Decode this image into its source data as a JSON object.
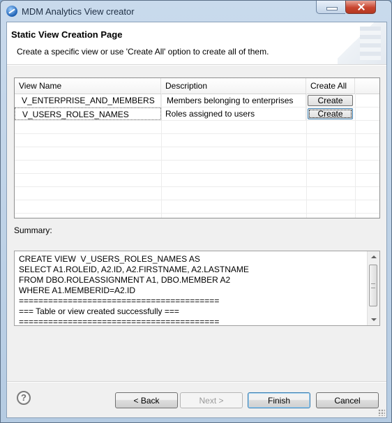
{
  "window": {
    "title": "MDM Analytics View creator",
    "icon": "app-globe-icon"
  },
  "header": {
    "title": "Static View Creation Page",
    "description": "Create a specific view or use 'Create All' option to create all of them."
  },
  "table": {
    "columns": [
      "View Name",
      "Description",
      "Create All"
    ],
    "rows": [
      {
        "view_name": "V_ENTERPRISE_AND_MEMBERS",
        "description": "Members belonging to enterprises",
        "action": "Create"
      },
      {
        "view_name": "V_USERS_ROLES_NAMES",
        "description": "Roles assigned to users",
        "action": "Create"
      }
    ]
  },
  "summary": {
    "label": "Summary:",
    "lines": [
      "CREATE VIEW  V_USERS_ROLES_NAMES AS",
      "SELECT A1.ROLEID, A2.ID, A2.FIRSTNAME, A2.LASTNAME",
      "FROM DBO.ROLEASSIGNMENT A1, DBO.MEMBER A2",
      "WHERE A1.MEMBERID=A2.ID",
      "=========================================",
      "=== Table or view created successfully ===",
      "========================================="
    ]
  },
  "buttons": {
    "help": "?",
    "back": "< Back",
    "next": "Next >",
    "finish": "Finish",
    "cancel": "Cancel"
  }
}
